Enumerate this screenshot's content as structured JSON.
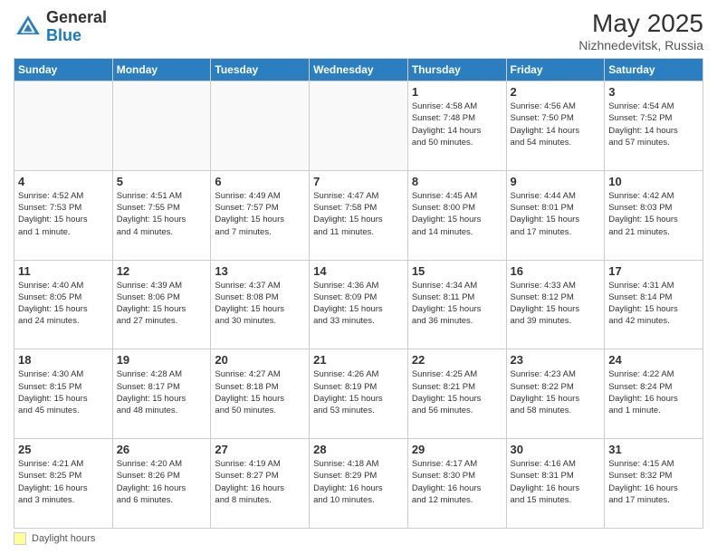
{
  "header": {
    "logo_general": "General",
    "logo_blue": "Blue",
    "month_year": "May 2025",
    "location": "Nizhnedevitsk, Russia"
  },
  "footer": {
    "daylight_label": "Daylight hours"
  },
  "days_of_week": [
    "Sunday",
    "Monday",
    "Tuesday",
    "Wednesday",
    "Thursday",
    "Friday",
    "Saturday"
  ],
  "weeks": [
    [
      {
        "num": "",
        "info": ""
      },
      {
        "num": "",
        "info": ""
      },
      {
        "num": "",
        "info": ""
      },
      {
        "num": "",
        "info": ""
      },
      {
        "num": "1",
        "info": "Sunrise: 4:58 AM\nSunset: 7:48 PM\nDaylight: 14 hours\nand 50 minutes."
      },
      {
        "num": "2",
        "info": "Sunrise: 4:56 AM\nSunset: 7:50 PM\nDaylight: 14 hours\nand 54 minutes."
      },
      {
        "num": "3",
        "info": "Sunrise: 4:54 AM\nSunset: 7:52 PM\nDaylight: 14 hours\nand 57 minutes."
      }
    ],
    [
      {
        "num": "4",
        "info": "Sunrise: 4:52 AM\nSunset: 7:53 PM\nDaylight: 15 hours\nand 1 minute."
      },
      {
        "num": "5",
        "info": "Sunrise: 4:51 AM\nSunset: 7:55 PM\nDaylight: 15 hours\nand 4 minutes."
      },
      {
        "num": "6",
        "info": "Sunrise: 4:49 AM\nSunset: 7:57 PM\nDaylight: 15 hours\nand 7 minutes."
      },
      {
        "num": "7",
        "info": "Sunrise: 4:47 AM\nSunset: 7:58 PM\nDaylight: 15 hours\nand 11 minutes."
      },
      {
        "num": "8",
        "info": "Sunrise: 4:45 AM\nSunset: 8:00 PM\nDaylight: 15 hours\nand 14 minutes."
      },
      {
        "num": "9",
        "info": "Sunrise: 4:44 AM\nSunset: 8:01 PM\nDaylight: 15 hours\nand 17 minutes."
      },
      {
        "num": "10",
        "info": "Sunrise: 4:42 AM\nSunset: 8:03 PM\nDaylight: 15 hours\nand 21 minutes."
      }
    ],
    [
      {
        "num": "11",
        "info": "Sunrise: 4:40 AM\nSunset: 8:05 PM\nDaylight: 15 hours\nand 24 minutes."
      },
      {
        "num": "12",
        "info": "Sunrise: 4:39 AM\nSunset: 8:06 PM\nDaylight: 15 hours\nand 27 minutes."
      },
      {
        "num": "13",
        "info": "Sunrise: 4:37 AM\nSunset: 8:08 PM\nDaylight: 15 hours\nand 30 minutes."
      },
      {
        "num": "14",
        "info": "Sunrise: 4:36 AM\nSunset: 8:09 PM\nDaylight: 15 hours\nand 33 minutes."
      },
      {
        "num": "15",
        "info": "Sunrise: 4:34 AM\nSunset: 8:11 PM\nDaylight: 15 hours\nand 36 minutes."
      },
      {
        "num": "16",
        "info": "Sunrise: 4:33 AM\nSunset: 8:12 PM\nDaylight: 15 hours\nand 39 minutes."
      },
      {
        "num": "17",
        "info": "Sunrise: 4:31 AM\nSunset: 8:14 PM\nDaylight: 15 hours\nand 42 minutes."
      }
    ],
    [
      {
        "num": "18",
        "info": "Sunrise: 4:30 AM\nSunset: 8:15 PM\nDaylight: 15 hours\nand 45 minutes."
      },
      {
        "num": "19",
        "info": "Sunrise: 4:28 AM\nSunset: 8:17 PM\nDaylight: 15 hours\nand 48 minutes."
      },
      {
        "num": "20",
        "info": "Sunrise: 4:27 AM\nSunset: 8:18 PM\nDaylight: 15 hours\nand 50 minutes."
      },
      {
        "num": "21",
        "info": "Sunrise: 4:26 AM\nSunset: 8:19 PM\nDaylight: 15 hours\nand 53 minutes."
      },
      {
        "num": "22",
        "info": "Sunrise: 4:25 AM\nSunset: 8:21 PM\nDaylight: 15 hours\nand 56 minutes."
      },
      {
        "num": "23",
        "info": "Sunrise: 4:23 AM\nSunset: 8:22 PM\nDaylight: 15 hours\nand 58 minutes."
      },
      {
        "num": "24",
        "info": "Sunrise: 4:22 AM\nSunset: 8:24 PM\nDaylight: 16 hours\nand 1 minute."
      }
    ],
    [
      {
        "num": "25",
        "info": "Sunrise: 4:21 AM\nSunset: 8:25 PM\nDaylight: 16 hours\nand 3 minutes."
      },
      {
        "num": "26",
        "info": "Sunrise: 4:20 AM\nSunset: 8:26 PM\nDaylight: 16 hours\nand 6 minutes."
      },
      {
        "num": "27",
        "info": "Sunrise: 4:19 AM\nSunset: 8:27 PM\nDaylight: 16 hours\nand 8 minutes."
      },
      {
        "num": "28",
        "info": "Sunrise: 4:18 AM\nSunset: 8:29 PM\nDaylight: 16 hours\nand 10 minutes."
      },
      {
        "num": "29",
        "info": "Sunrise: 4:17 AM\nSunset: 8:30 PM\nDaylight: 16 hours\nand 12 minutes."
      },
      {
        "num": "30",
        "info": "Sunrise: 4:16 AM\nSunset: 8:31 PM\nDaylight: 16 hours\nand 15 minutes."
      },
      {
        "num": "31",
        "info": "Sunrise: 4:15 AM\nSunset: 8:32 PM\nDaylight: 16 hours\nand 17 minutes."
      }
    ]
  ]
}
